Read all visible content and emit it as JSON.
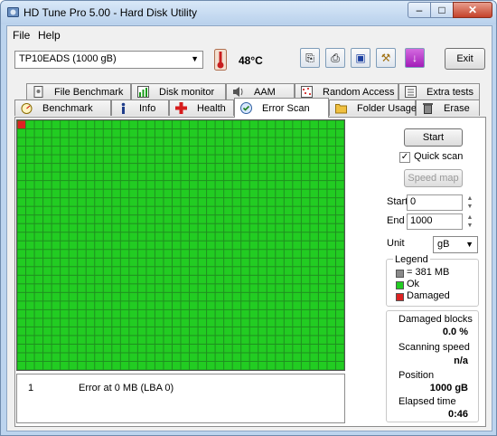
{
  "window": {
    "title": "HD Tune Pro 5.00 - Hard Disk Utility"
  },
  "menu": [
    {
      "label": "File"
    },
    {
      "label": "Help"
    }
  ],
  "toolbar": {
    "drive": "TP10EADS (1000 gB)",
    "temperature": "48°C",
    "exit_label": "Exit"
  },
  "tabs_top": [
    {
      "label": "File Benchmark"
    },
    {
      "label": "Disk monitor"
    },
    {
      "label": "AAM"
    },
    {
      "label": "Random Access"
    },
    {
      "label": "Extra tests"
    }
  ],
  "tabs_bottom": [
    {
      "label": "Benchmark"
    },
    {
      "label": "Info"
    },
    {
      "label": "Health"
    },
    {
      "label": "Error Scan",
      "active": true
    },
    {
      "label": "Folder Usage"
    },
    {
      "label": "Erase"
    }
  ],
  "scan": {
    "columns": 38,
    "rows": 29,
    "damaged_blocks_indices": [
      0
    ],
    "ok_color": "#22cc22",
    "damaged_color": "#dd2222"
  },
  "log": [
    {
      "index": "1",
      "message": "Error at 0 MB (LBA 0)"
    }
  ],
  "controls": {
    "start_label": "Start",
    "quick_scan_label": "Quick scan",
    "quick_scan_checked": true,
    "speed_map_label": "Speed map",
    "start_field_label": "Start",
    "start_value": "0",
    "end_field_label": "End",
    "end_value": "1000",
    "unit_label": "Unit",
    "unit_value": "gB"
  },
  "legend": {
    "title": "Legend",
    "items": [
      {
        "label": "= 381 MB",
        "color": "#8a8a8a"
      },
      {
        "label": "Ok",
        "color": "#22cc22"
      },
      {
        "label": "Damaged",
        "color": "#dd2222"
      }
    ]
  },
  "stats": {
    "damaged_blocks_label": "Damaged blocks",
    "damaged_blocks_value": "0.0 %",
    "scanning_speed_label": "Scanning speed",
    "scanning_speed_value": "n/a",
    "position_label": "Position",
    "position_value": "1000 gB",
    "elapsed_label": "Elapsed time",
    "elapsed_value": "0:46"
  }
}
